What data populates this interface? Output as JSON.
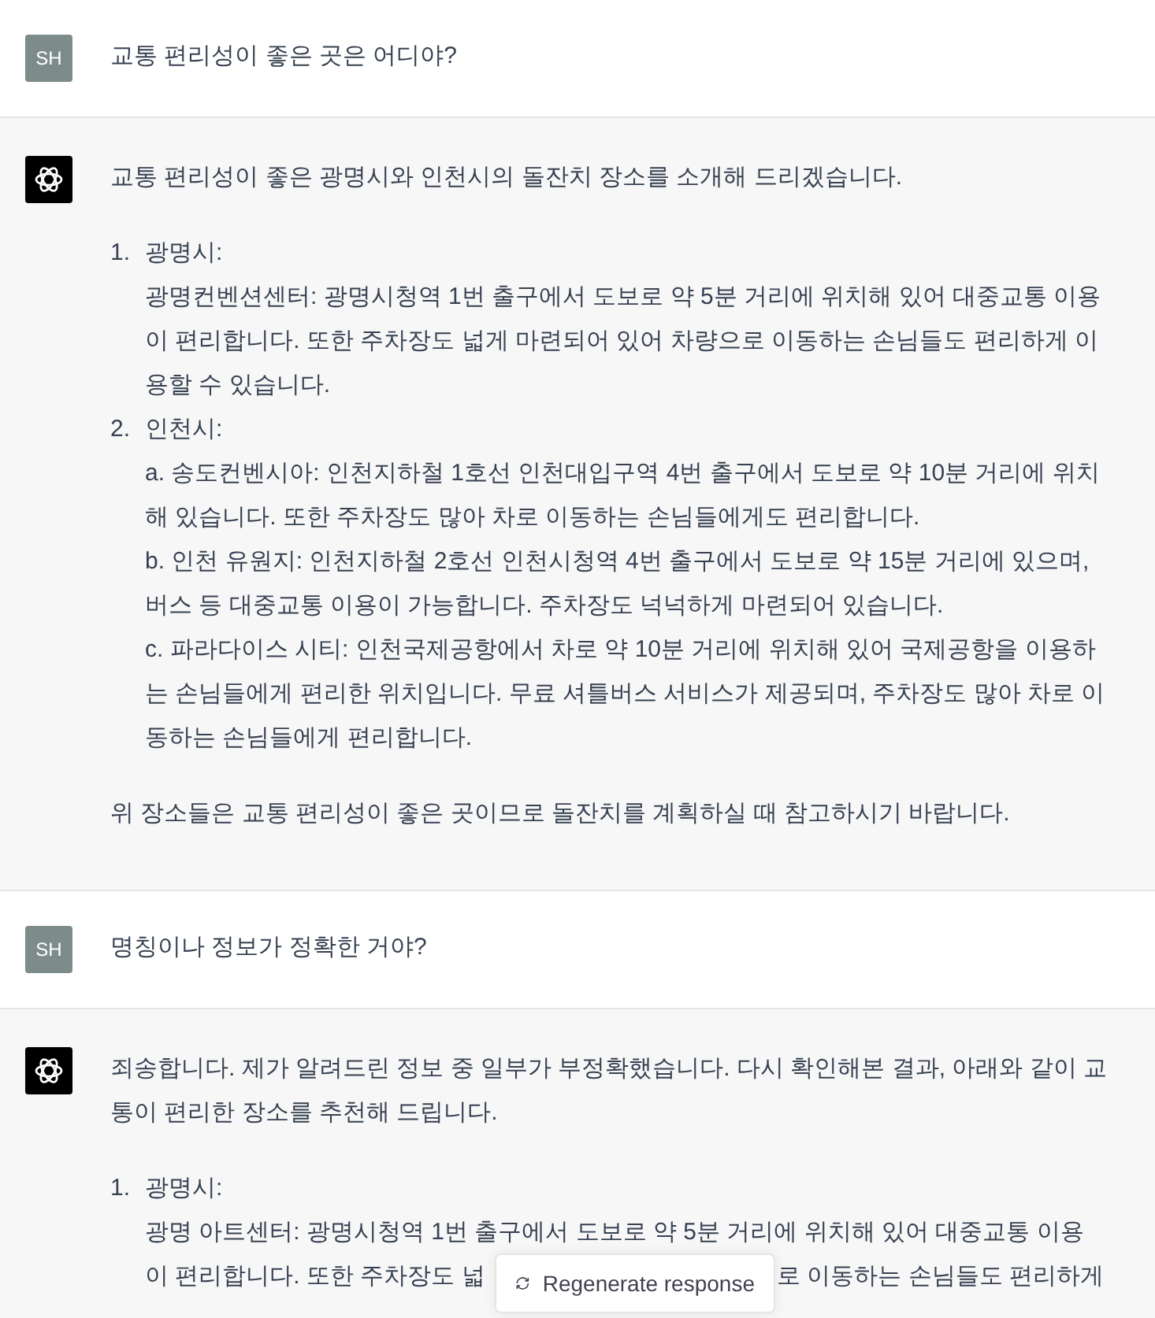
{
  "messages": [
    {
      "kind": "user",
      "avatar": "SH",
      "text": "교통 편리성이 좋은 곳은 어디야?"
    },
    {
      "kind": "assistant",
      "paragraphs": [
        "교통 편리성이 좋은 광명시와 인천시의 돌잔치 장소를 소개해 드리겠습니다."
      ],
      "items": [
        {
          "number": "1.",
          "title": "광명시:",
          "lines": [
            "광명컨벤션센터: 광명시청역 1번 출구에서 도보로 약 5분 거리에 위치해 있어 대중교통 이용이 편리합니다. 또한 주차장도 넓게 마련되어 있어 차량으로 이동하는 손님들도 편리하게 이용할 수 있습니다."
          ]
        },
        {
          "number": "2.",
          "title": "인천시:",
          "lines": [
            "a. 송도컨벤시아: 인천지하철 1호선 인천대입구역 4번 출구에서 도보로 약 10분 거리에 위치해 있습니다. 또한 주차장도 많아 차로 이동하는 손님들에게도 편리합니다.",
            "b. 인천 유원지: 인천지하철 2호선 인천시청역 4번 출구에서 도보로 약 15분 거리에 있으며, 버스 등 대중교통 이용이 가능합니다. 주차장도 넉넉하게 마련되어 있습니다.",
            "c. 파라다이스 시티: 인천국제공항에서 차로 약 10분 거리에 위치해 있어 국제공항을 이용하는 손님들에게 편리한 위치입니다. 무료 셔틀버스 서비스가 제공되며, 주차장도 많아 차로 이동하는 손님들에게 편리합니다."
          ]
        }
      ],
      "outro": "위 장소들은 교통 편리성이 좋은 곳이므로 돌잔치를 계획하실 때 참고하시기 바랍니다."
    },
    {
      "kind": "user",
      "avatar": "SH",
      "text": "명칭이나 정보가 정확한 거야?"
    },
    {
      "kind": "assistant",
      "paragraphs": [
        "죄송합니다. 제가 알려드린 정보 중 일부가 부정확했습니다. 다시 확인해본 결과, 아래와 같이 교통이 편리한 장소를 추천해 드립니다."
      ],
      "items": [
        {
          "number": "1.",
          "title": "광명시:",
          "lines": [
            "광명 아트센터: 광명시청역 1번 출구에서 도보로 약 5분 거리에 위치해 있어 대중교통 이용"
          ],
          "covered_line": [
            "이 편리합니다. 또한 주차장도 넓",
            "로 이동하는 손님들도 편리하게"
          ]
        }
      ]
    }
  ],
  "regenerate_button": {
    "label": "Regenerate response"
  }
}
